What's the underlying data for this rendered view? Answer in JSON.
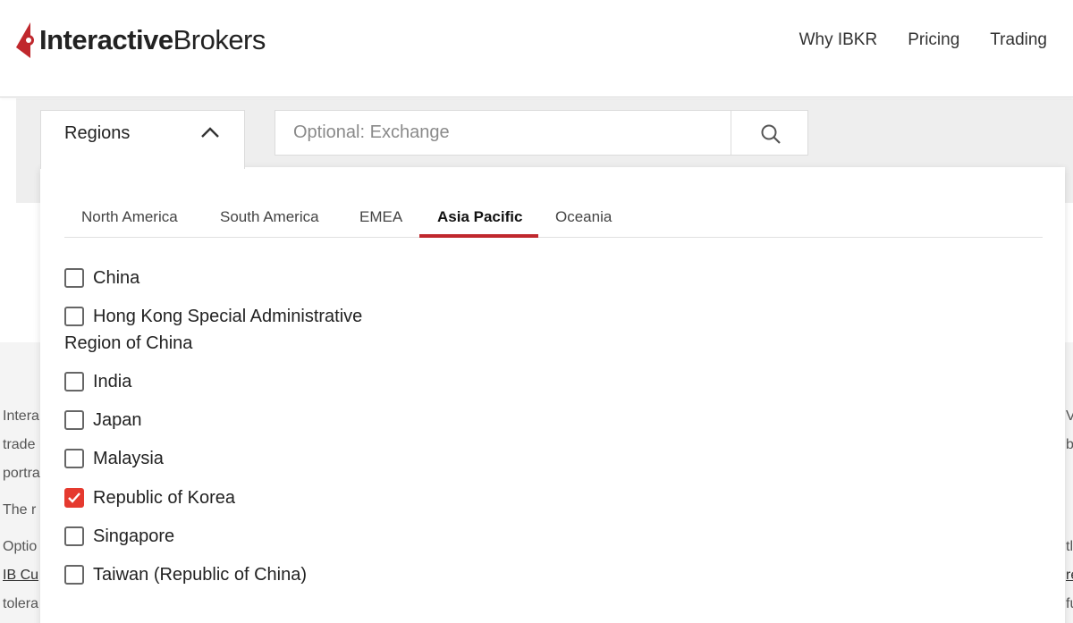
{
  "header": {
    "logo": {
      "bold": "Interactive",
      "light": "Brokers",
      "color": "#c0282d"
    },
    "nav": [
      "Why IBKR",
      "Pricing",
      "Trading"
    ]
  },
  "search": {
    "regions_label": "Regions",
    "exchange_placeholder": "Optional: Exchange",
    "search_icon": "search-icon",
    "chevron_icon": "chevron-up-icon"
  },
  "dropdown": {
    "tabs": [
      "North America",
      "South America",
      "EMEA",
      "Asia Pacific",
      "Oceania"
    ],
    "active_tab": "Asia Pacific",
    "accent_color": "#c0282d",
    "checkbox_checked_color": "#e53a2f",
    "options": [
      {
        "label": "China",
        "checked": false
      },
      {
        "label": "Hong Kong Special Administrative",
        "label_cont": "Region of China",
        "checked": false
      },
      {
        "label": "India",
        "checked": false
      },
      {
        "label": "Japan",
        "checked": false
      },
      {
        "label": "Malaysia",
        "checked": false
      },
      {
        "label": "Republic of Korea",
        "checked": true
      },
      {
        "label": "Singapore",
        "checked": false
      },
      {
        "label": "Taiwan (Republic of China)",
        "checked": false
      }
    ]
  },
  "background_text": {
    "left": [
      "Intera",
      "trade",
      "portra",
      "The r",
      "Optio",
      "IB Cu",
      "tolera"
    ],
    "right": [
      "V",
      "b",
      "tl",
      "re",
      "fu"
    ]
  }
}
